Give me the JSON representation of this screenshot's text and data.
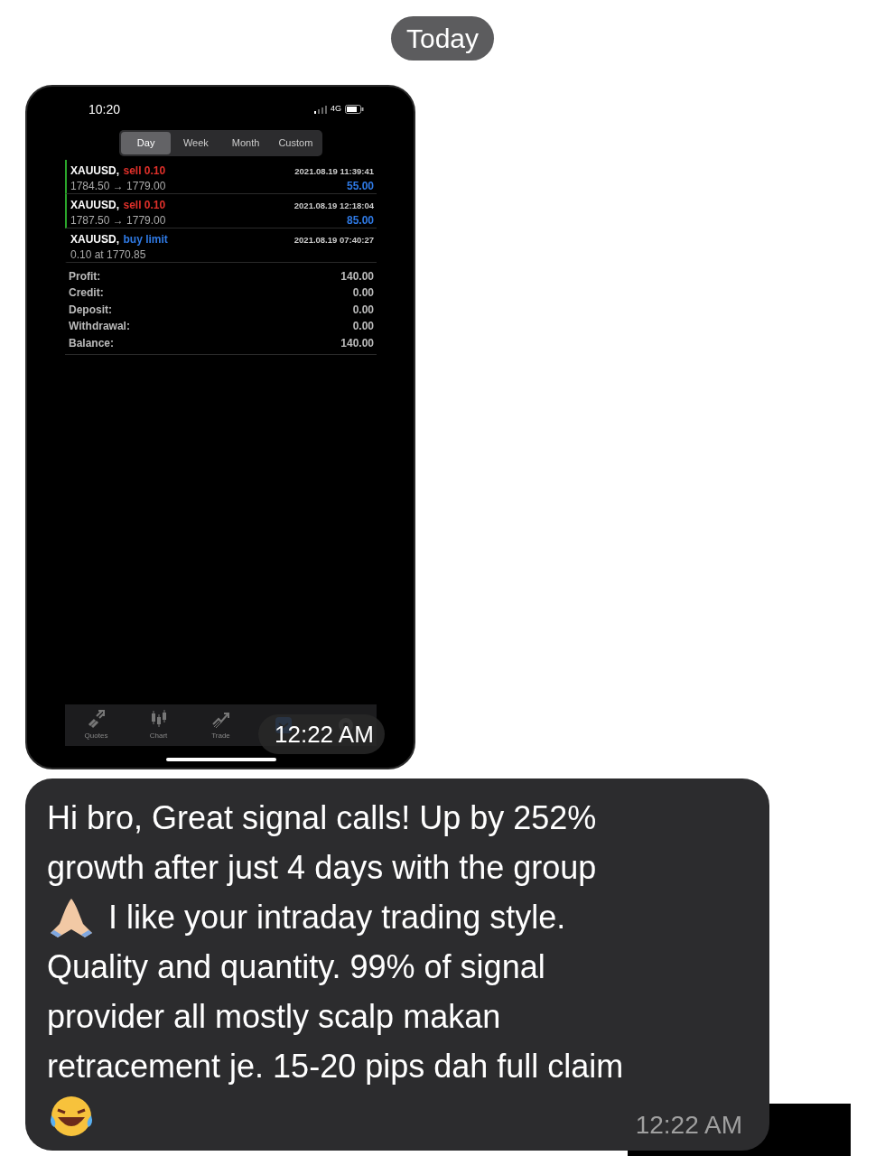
{
  "date_divider": "Today",
  "image_message": {
    "time": "12:22 AM",
    "screenshot": {
      "status_bar": {
        "time": "10:20",
        "network": "4G"
      },
      "periods": [
        {
          "label": "Day",
          "selected": true
        },
        {
          "label": "Week",
          "selected": false
        },
        {
          "label": "Month",
          "selected": false
        },
        {
          "label": "Custom",
          "selected": false
        }
      ],
      "deals": [
        {
          "symbol": "XAUUSD,",
          "action": "sell 0.10",
          "color": "#e0302a",
          "marked": true,
          "time": "2021.08.19 11:39:41",
          "detail": "1784.50 → 1779.00",
          "profit": "55.00"
        },
        {
          "symbol": "XAUUSD,",
          "action": "sell 0.10",
          "color": "#e0302a",
          "marked": true,
          "time": "2021.08.19 12:18:04",
          "detail": "1787.50 → 1779.00",
          "profit": "85.00"
        },
        {
          "symbol": "XAUUSD,",
          "action": "buy limit",
          "color": "#2f7ae5",
          "marked": false,
          "time": "2021.08.19 07:40:27",
          "detail": "0.10 at 1770.85"
        }
      ],
      "summary": [
        {
          "label": "Profit:",
          "value": "140.00"
        },
        {
          "label": "Credit:",
          "value": "0.00"
        },
        {
          "label": "Deposit:",
          "value": "0.00"
        },
        {
          "label": "Withdrawal:",
          "value": "0.00"
        },
        {
          "label": "Balance:",
          "value": "140.00"
        }
      ],
      "tabs": [
        {
          "kind": "quotes",
          "label": "Quotes",
          "selected": false
        },
        {
          "kind": "chart",
          "label": "Chart",
          "selected": false
        },
        {
          "kind": "trade",
          "label": "Trade",
          "selected": false
        },
        {
          "kind": "history",
          "selected": true
        },
        {
          "kind": "settings",
          "selected": false
        }
      ]
    }
  },
  "text_message": {
    "lines": [
      {
        "kind": "text",
        "text": "Hi bro, Great signal calls! Up by 252%"
      },
      {
        "kind": "text",
        "text": "growth after just 4 days with the group"
      },
      {
        "kind": "pray",
        "text": "I like your intraday trading style."
      },
      {
        "kind": "text",
        "text": "Quality and quantity. 99% of signal"
      },
      {
        "kind": "text",
        "text": "provider all mostly scalp makan"
      },
      {
        "kind": "text",
        "text": "retracement je. 15-20 pips dah full claim"
      },
      {
        "kind": "laugh"
      }
    ],
    "time": "12:22 AM"
  }
}
